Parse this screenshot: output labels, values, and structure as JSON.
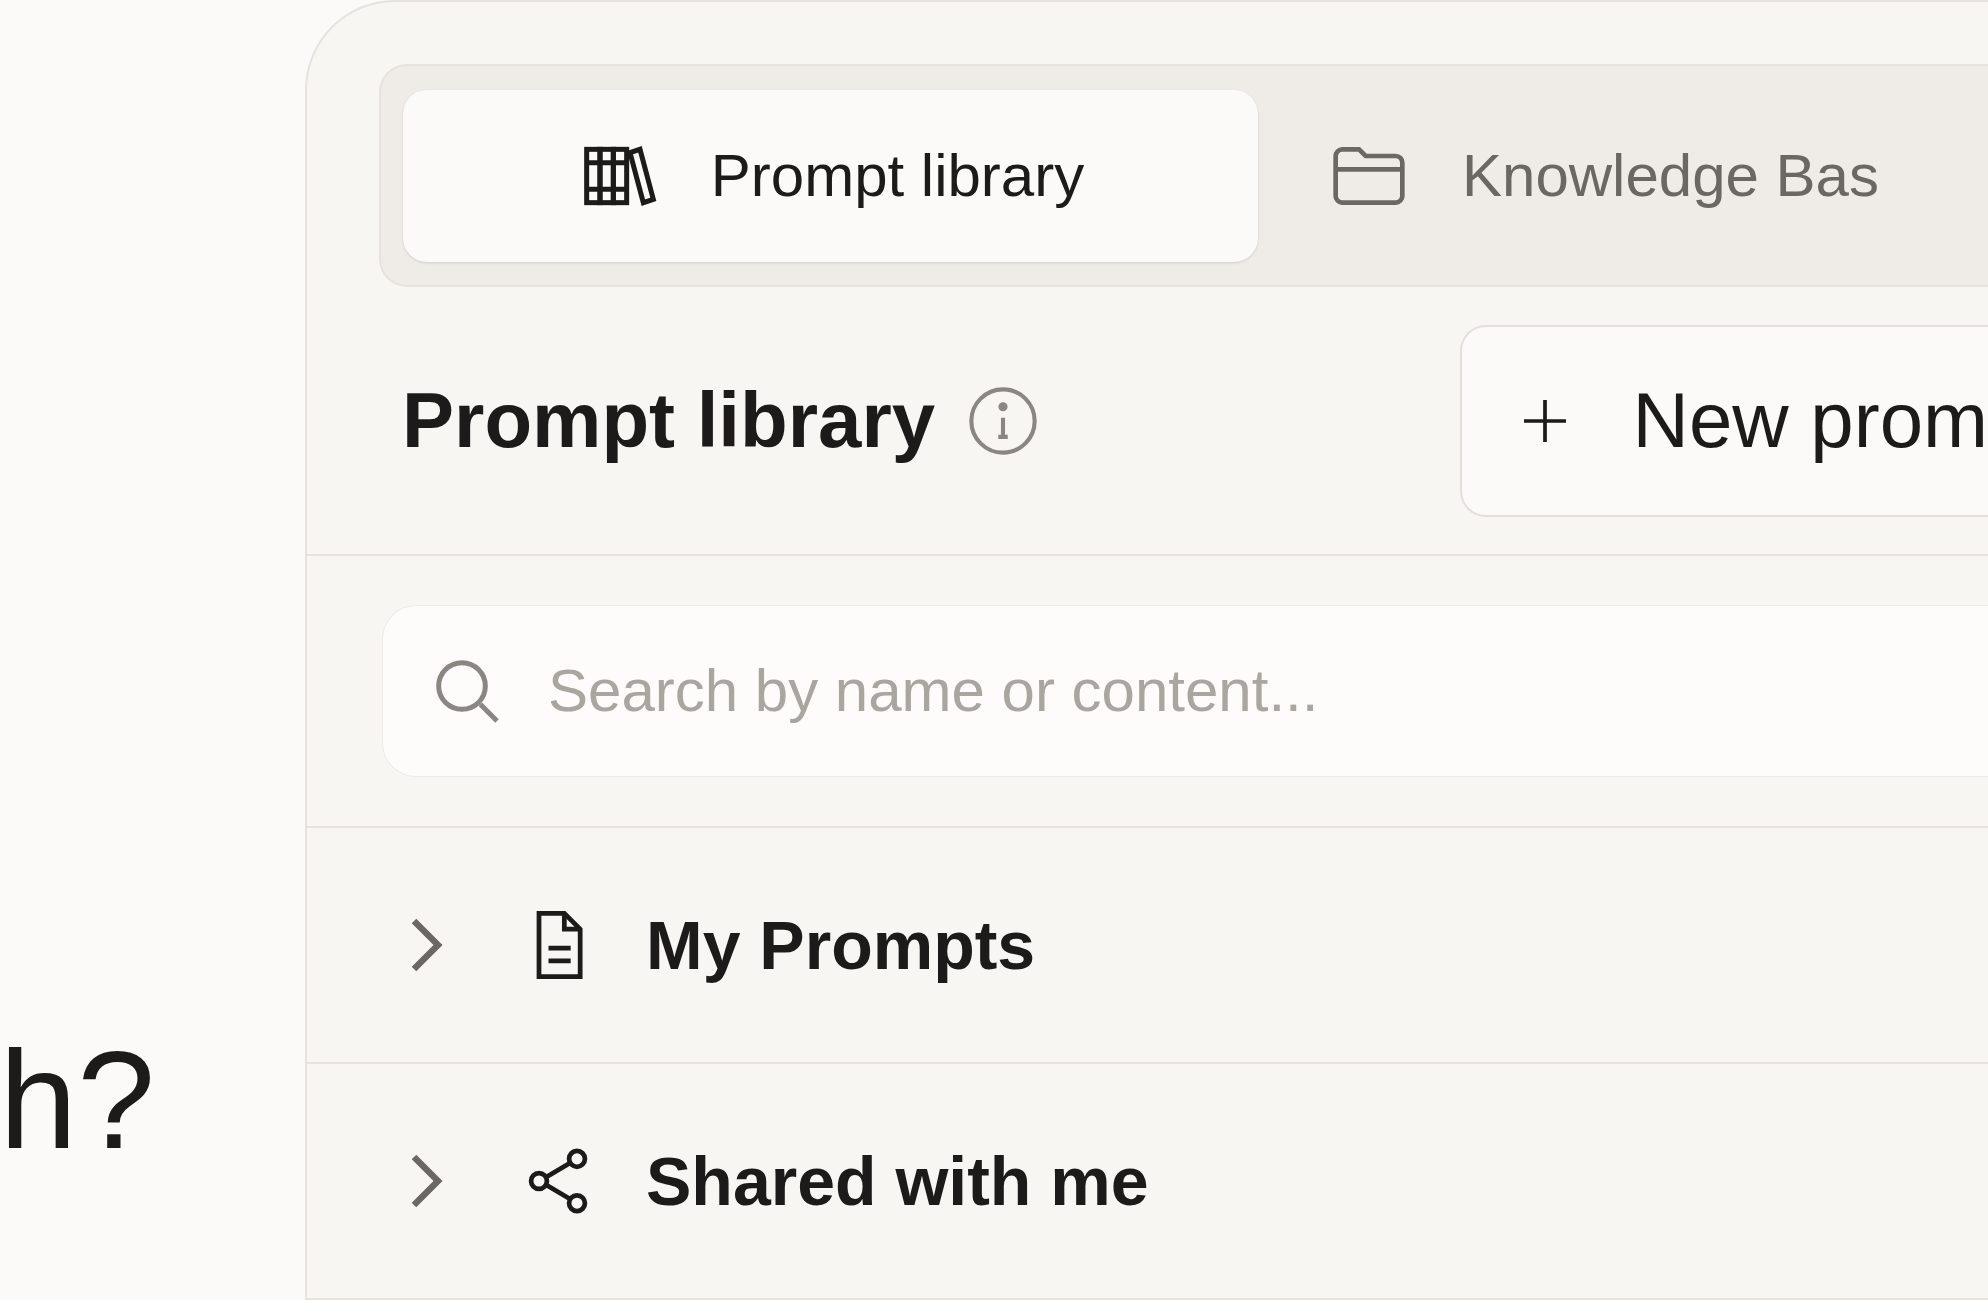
{
  "background_text": "h?",
  "tabs": [
    {
      "label": "Prompt library",
      "selected": true
    },
    {
      "label": "Knowledge Bas",
      "selected": false
    }
  ],
  "header": {
    "title": "Prompt library",
    "new_button": "New prom"
  },
  "search": {
    "placeholder": "Search by name or content..."
  },
  "sections": [
    {
      "label": "My Prompts",
      "expanded": false
    },
    {
      "label": "Shared with me",
      "expanded": false
    }
  ]
}
